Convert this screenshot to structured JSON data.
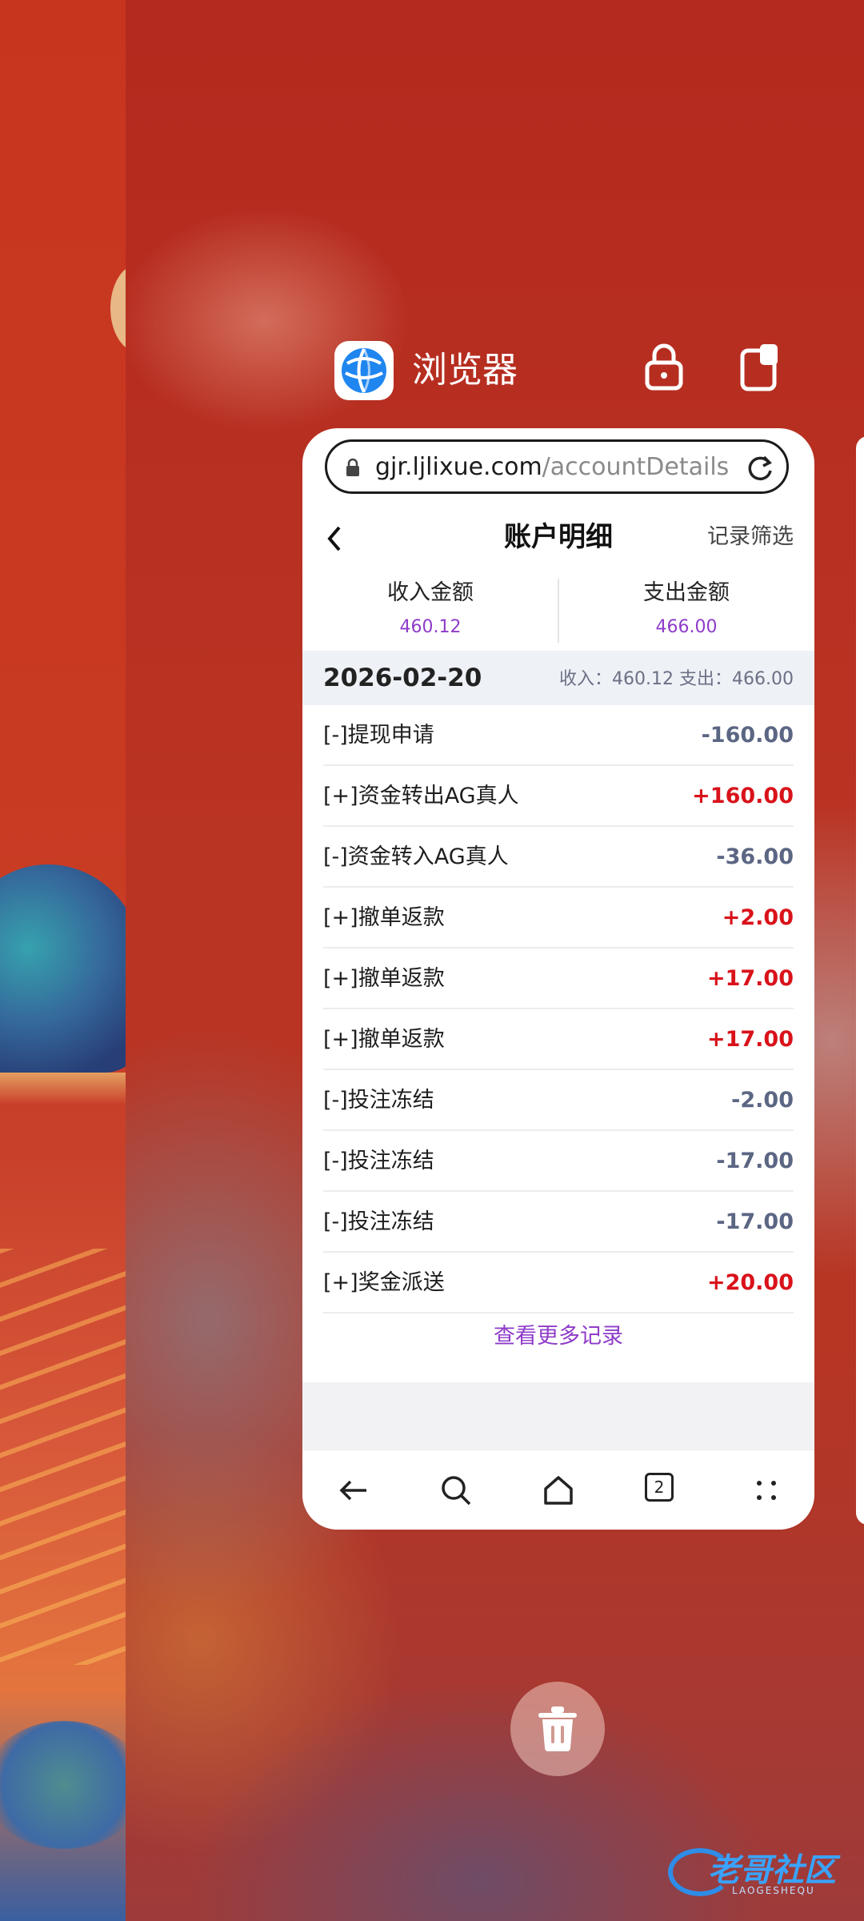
{
  "app": {
    "name": "浏览器"
  },
  "browser": {
    "url_host": "gjr.ljlixue.com",
    "url_path": "/accountDetails",
    "tab_count": "2"
  },
  "page": {
    "title": "账户明细",
    "filter_label": "记录筛选",
    "income_label": "收入金额",
    "income_value": "460.12",
    "expense_label": "支出金额",
    "expense_value": "466.00",
    "date": "2026-02-20",
    "day_totals": "收入：460.12  支出：466.00",
    "more_label": "查看更多记录"
  },
  "records": [
    {
      "name": "[-]提现申请",
      "amount": "-160.00",
      "sign": "neg"
    },
    {
      "name": "[+]资金转出AG真人",
      "amount": "+160.00",
      "sign": "pos"
    },
    {
      "name": "[-]资金转入AG真人",
      "amount": "-36.00",
      "sign": "neg"
    },
    {
      "name": "[+]撤单返款",
      "amount": "+2.00",
      "sign": "pos"
    },
    {
      "name": "[+]撤单返款",
      "amount": "+17.00",
      "sign": "pos"
    },
    {
      "name": "[+]撤单返款",
      "amount": "+17.00",
      "sign": "pos"
    },
    {
      "name": "[-]投注冻结",
      "amount": "-2.00",
      "sign": "neg"
    },
    {
      "name": "[-]投注冻结",
      "amount": "-17.00",
      "sign": "neg"
    },
    {
      "name": "[-]投注冻结",
      "amount": "-17.00",
      "sign": "neg"
    },
    {
      "name": "[+]奖金派送",
      "amount": "+20.00",
      "sign": "pos"
    }
  ],
  "watermark": {
    "text": "老哥社区",
    "sub": "LAOGESHEQU"
  },
  "colors": {
    "accent_purple": "#8e3cc9",
    "positive_red": "#d9121a",
    "negative_slate": "#5b6683"
  },
  "icons": [
    "browser-globe-icon",
    "lock-icon",
    "split-screen-icon",
    "reload-icon",
    "back-chevron-icon",
    "nav-back-icon",
    "search-icon",
    "home-icon",
    "tabs-icon",
    "menu-dots-icon",
    "trash-icon"
  ]
}
